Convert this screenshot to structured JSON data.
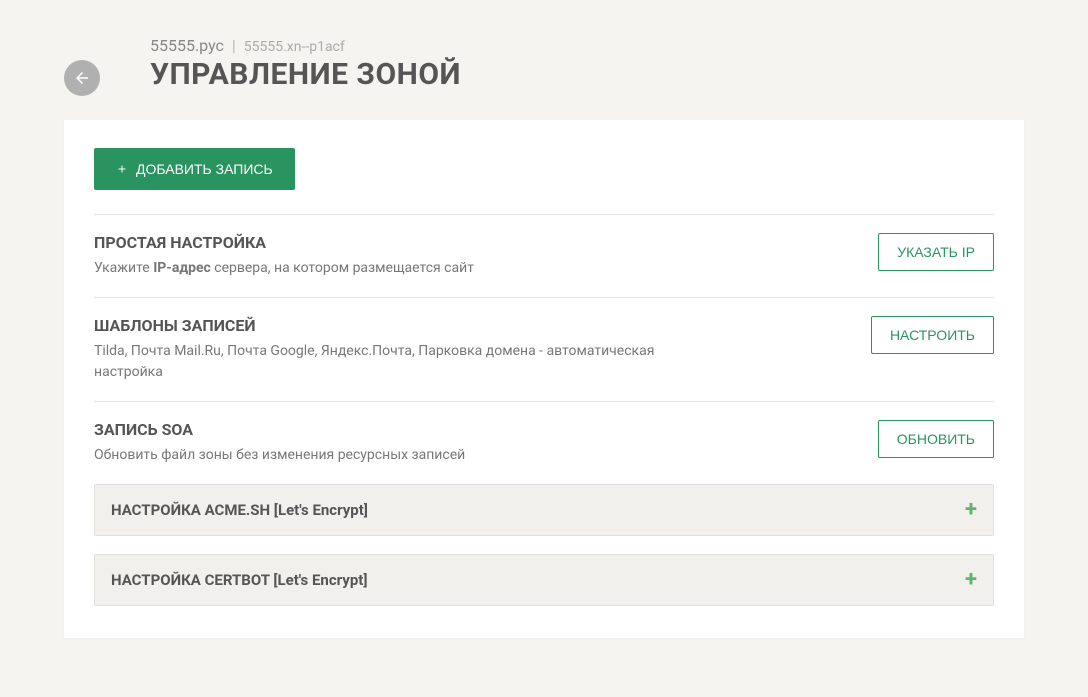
{
  "header": {
    "domain_display": "55555.рус",
    "separator": "|",
    "domain_punycode": "55555.xn--p1acf",
    "page_title": "УПРАВЛЕНИЕ ЗОНОЙ"
  },
  "add_button": "ДОБАВИТЬ ЗАПИСЬ",
  "sections": [
    {
      "title": "ПРОСТАЯ НАСТРОЙКА",
      "desc_prefix": "Укажите ",
      "desc_bold": "IP-адрес",
      "desc_suffix": " сервера, на котором размещается сайт",
      "button": "УКАЗАТЬ IP"
    },
    {
      "title": "ШАБЛОНЫ ЗАПИСЕЙ",
      "desc_prefix": "Tilda, Почта Mail.Ru, Почта Google, Яндекс.Почта, Парковка домена - автоматическая настройка",
      "desc_bold": "",
      "desc_suffix": "",
      "button": "НАСТРОИТЬ"
    },
    {
      "title": "ЗАПИСЬ SOA",
      "desc_prefix": "Обновить файл зоны без изменения ресурсных записей",
      "desc_bold": "",
      "desc_suffix": "",
      "button": "ОБНОВИТЬ"
    }
  ],
  "accordions": [
    {
      "title": "НАСТРОЙКА ACME.SH [Let's Encrypt]"
    },
    {
      "title": "НАСТРОЙКА CERTBOT [Let's Encrypt]"
    }
  ]
}
